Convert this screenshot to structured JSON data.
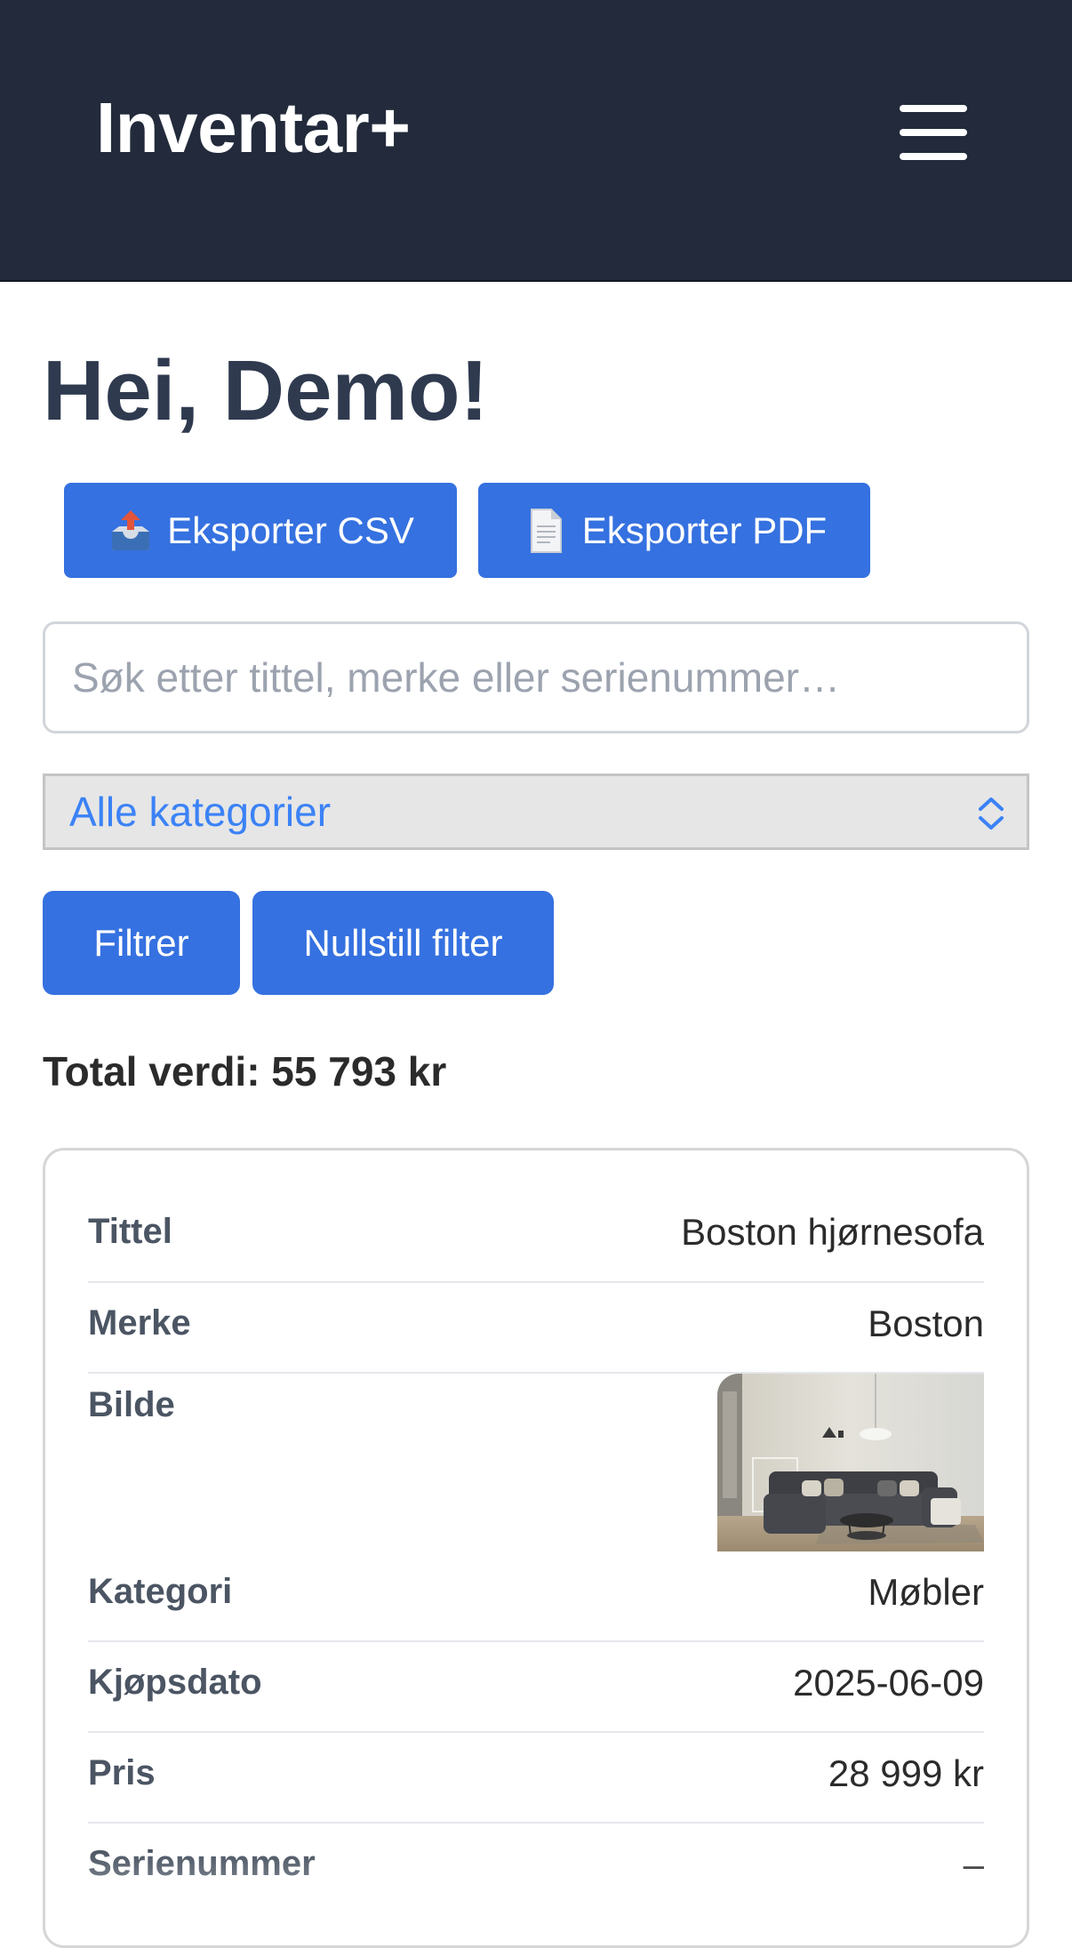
{
  "header": {
    "brand": "Inventar+",
    "menu_icon": "hamburger-menu-icon"
  },
  "main": {
    "greeting": "Hei, Demo!",
    "export_csv_label": "Eksporter CSV",
    "export_csv_icon": "outbox-tray-icon",
    "export_pdf_label": "Eksporter PDF",
    "export_pdf_icon": "document-icon",
    "search_placeholder": "Søk etter tittel, merke eller serienummer…",
    "search_value": "",
    "category_selected": "Alle kategorier",
    "filter_label": "Filtrer",
    "reset_label": "Nullstill filter",
    "total_value": "Total verdi: 55 793 kr"
  },
  "item": {
    "fields": [
      {
        "label": "Tittel",
        "value": "Boston hjørnesofa"
      },
      {
        "label": "Merke",
        "value": "Boston"
      },
      {
        "label": "Bilde",
        "value": ""
      },
      {
        "label": "Kategori",
        "value": "Møbler"
      },
      {
        "label": "Kjøpsdato",
        "value": "2025-06-09"
      },
      {
        "label": "Pris",
        "value": "28 999 kr"
      },
      {
        "label": "Serienummer",
        "value": "–"
      }
    ]
  },
  "colors": {
    "header_bg": "#222a3b",
    "accent": "#3571e0",
    "select_text": "#3b82f6"
  }
}
